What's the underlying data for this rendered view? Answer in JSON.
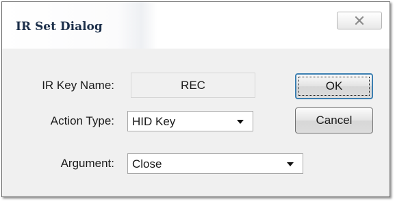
{
  "dialog": {
    "title": "IR Set Dialog",
    "close_icon": "close-x-icon"
  },
  "form": {
    "ir_key_name_label": "IR Key Name:",
    "ir_key_name_value": "REC",
    "action_type_label": "Action Type:",
    "action_type_value": "HID Key",
    "argument_label": "Argument:",
    "argument_value": "Close"
  },
  "buttons": {
    "ok_label": "OK",
    "cancel_label": "Cancel"
  },
  "colors": {
    "title_text": "#1c2f4a",
    "dialog_bg": "#f0f0f0",
    "ok_focus_border": "#3c7fb1"
  }
}
